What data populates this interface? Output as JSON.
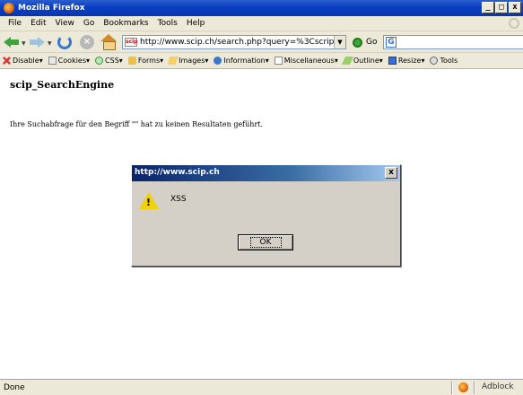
{
  "window": {
    "title": "Mozilla Firefox",
    "controls": [
      "_",
      "□",
      "x"
    ]
  },
  "menu": {
    "items": [
      "File",
      "Edit",
      "View",
      "Go",
      "Bookmarks",
      "Tools",
      "Help"
    ]
  },
  "nav": {
    "url": "http://www.scip.ch/search.php?query=%3Cscrip",
    "go_label": "Go",
    "favicon_text": "scip"
  },
  "devtoolbar": {
    "items": [
      "Disable",
      "Cookies",
      "CSS",
      "Forms",
      "Images",
      "Information",
      "Miscellaneous",
      "Outline",
      "Resize",
      "Tools"
    ]
  },
  "page": {
    "heading": "scip_SearchEngine",
    "text": "Ihre Suchabfrage für den Begriff \"\" hat zu keinen Resultaten geführt."
  },
  "dialog": {
    "title": "http://www.scip.ch",
    "message": "XSS",
    "ok_label": "OK",
    "close": "x",
    "icon_glyph": "!"
  },
  "status": {
    "text": "Done",
    "adblock": "Adblock"
  }
}
